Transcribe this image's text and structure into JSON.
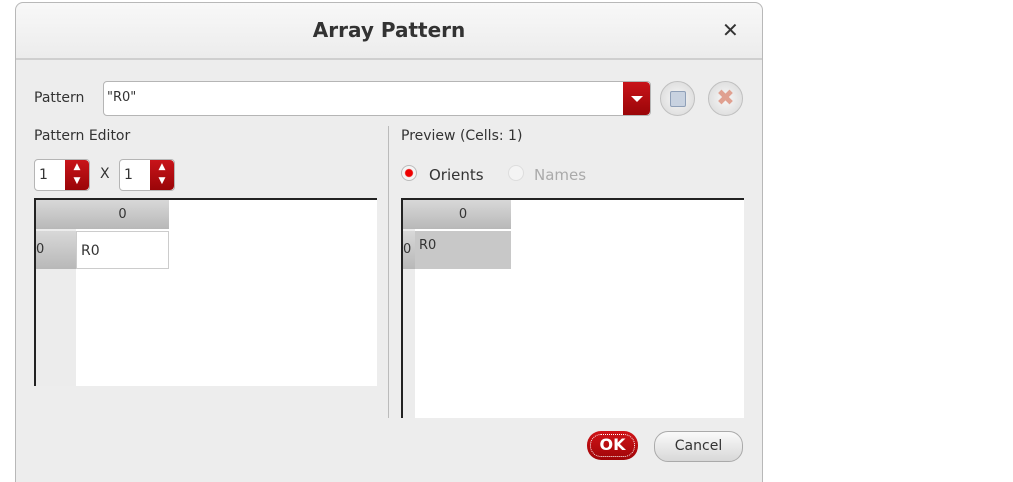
{
  "dialog": {
    "title": "Array Pattern",
    "close_icon": "close-icon"
  },
  "pattern": {
    "label": "Pattern",
    "value": "\"R0\""
  },
  "editor": {
    "label": "Pattern Editor",
    "rows": "1",
    "cols": "1",
    "x_label": "X",
    "col_header": "0",
    "row_header": "0",
    "cell": "R0"
  },
  "preview": {
    "label": "Preview (Cells: 1)",
    "radio_orients": "Orients",
    "radio_names": "Names",
    "col_header": "0",
    "row_header": "0",
    "cell": "R0"
  },
  "buttons": {
    "ok": "OK",
    "cancel": "Cancel"
  },
  "colors": {
    "accent": "#b00a0f"
  }
}
